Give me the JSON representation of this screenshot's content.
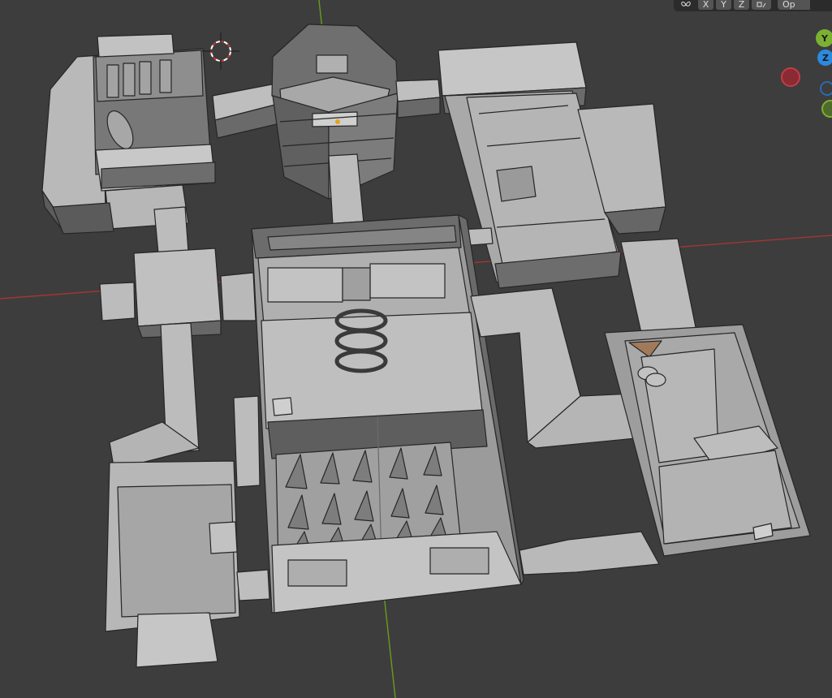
{
  "header": {
    "axis_x_label": "X",
    "axis_y_label": "Y",
    "axis_z_label": "Z",
    "options_label": "Op",
    "mirror_icon": "butterfly-mirror-icon",
    "snap_icon": "snap-icon"
  },
  "gizmo": {
    "y_label": "Y",
    "z_label": "Z",
    "x_color": "#c63b48",
    "y_color": "#7ab132",
    "z_color": "#2b8ae0"
  },
  "colors": {
    "background": "#3d3d3d",
    "grid_x_axis": "#b33a3a",
    "grid_y_axis": "#6b9b1c",
    "mesh_face": "#a6a6a6",
    "mesh_edge": "#262626",
    "cursor_red": "#d03030"
  }
}
